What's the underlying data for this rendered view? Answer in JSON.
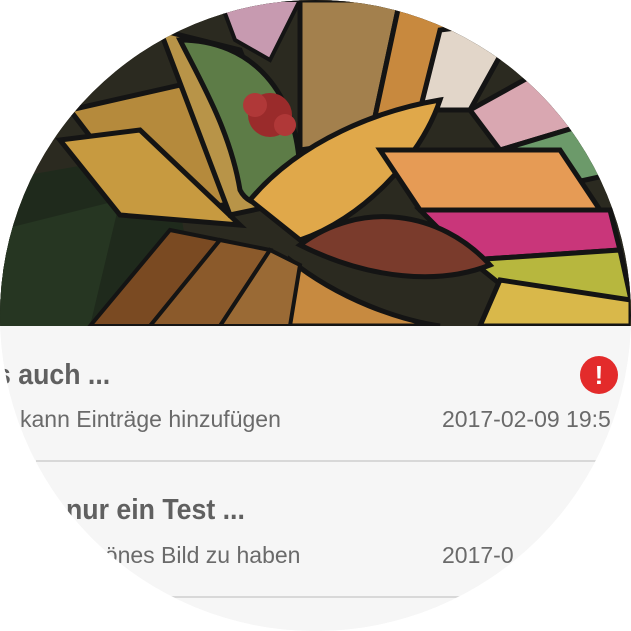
{
  "header": {
    "image_description_icon": "stained-glass-image"
  },
  "entries": [
    {
      "title": "s auch ...",
      "subtitle": "kann Einträge hinzufügen",
      "date": "2017-02-09 19:5",
      "alert_symbol": "!",
      "alert_color": "#e32b2b"
    },
    {
      "title": "nur ein Test ...",
      "subtitle": "nönes Bild zu haben",
      "date": "2017-0"
    }
  ],
  "colors": {
    "list_background": "#f6f6f6",
    "text": "#606060",
    "alert": "#e32b2b"
  }
}
